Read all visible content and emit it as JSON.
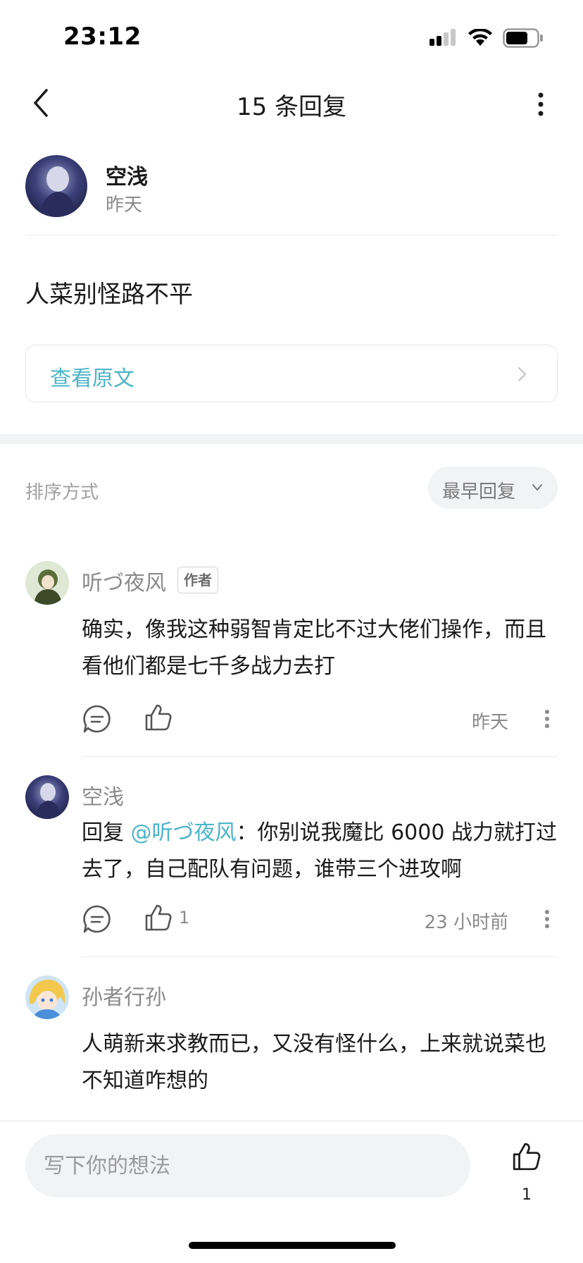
{
  "status_bar": {
    "time": "23:12"
  },
  "nav": {
    "title": "15 条回复"
  },
  "post": {
    "author": "空浅",
    "time": "昨天",
    "text": "人菜别怪路不平",
    "view_original_label": "查看原文"
  },
  "sort": {
    "label": "排序方式",
    "selected": "最早回复"
  },
  "comments": [
    {
      "name": "听づ夜风",
      "tag": "作者",
      "text": "确实，像我这种弱智肯定比不过大佬们操作，而且看他们都是七千多战力去打",
      "like_count": "",
      "time": "昨天"
    },
    {
      "name": "空浅",
      "reply_prefix": "回复 ",
      "mention": "@听づ夜风",
      "text": "：你别说我魔比 6000 战力就打过去了，自己配队有问题，谁带三个进攻啊",
      "like_count": "1",
      "time": "23 小时前"
    },
    {
      "name": "孙者行孙",
      "text": "人萌新来求教而已，又没有怪什么，上来就说菜也不知道咋想的"
    }
  ],
  "bottom_bar": {
    "input_placeholder": "写下你的想法",
    "like_count": "1"
  },
  "colors": {
    "accent": "#4bb4c8",
    "secondary_text": "#8a8a8a",
    "background_gray": "#f2f3f5"
  },
  "icons": {
    "status": [
      "cellular-signal-icon",
      "wifi-icon",
      "battery-icon"
    ],
    "nav": [
      "back-arrow-icon",
      "more-vertical-icon"
    ],
    "comment_actions": [
      "reply-bubble-icon",
      "thumbs-up-icon",
      "more-vertical-icon"
    ]
  }
}
